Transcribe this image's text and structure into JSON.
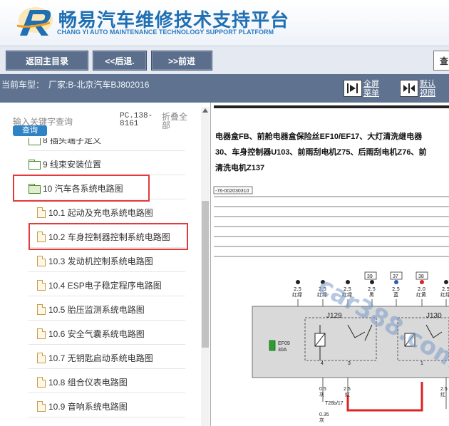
{
  "header": {
    "title_cn": "畅易汽车维修技术支持平台",
    "title_en": "CHANG YI AUTO MAINTENANCE TECHNOLOGY SUPPORT PLATFORM",
    "logo_icon": "cy-logo-icon"
  },
  "toolbar": {
    "home_label": "返回主目录",
    "back_label": "<<后退.",
    "forward_label": ">>前进",
    "query_label": "查"
  },
  "infobar": {
    "model_label": "当前车型：",
    "model_value": "厂家:B-北京汽车BJ802016",
    "fullscreen_label_1": "全屏",
    "fullscreen_label_2": "菜单",
    "default_label_1": "默认",
    "default_label_2": "视图"
  },
  "left": {
    "search_placeholder": "输入关键字查询",
    "search_button": "查询",
    "pc_code_1": "PC.138-",
    "pc_code_2": "8161",
    "collapse_1": "折叠全",
    "collapse_2": "部",
    "tree": [
      {
        "label": "8 插头端子定义",
        "type": "folder",
        "depth": 0
      },
      {
        "label": "9 线束安装位置",
        "type": "folder",
        "depth": 0
      },
      {
        "label": "10 汽车各系统电路图",
        "type": "folder-open",
        "depth": 0,
        "highlight": true
      },
      {
        "label": "10.1 起动及充电系统电路图",
        "type": "doc",
        "depth": 1
      },
      {
        "label": "10.2 车身控制器控制系统电路图",
        "type": "doc",
        "depth": 1,
        "highlight": true
      },
      {
        "label": "10.3 发动机控制系统电路图",
        "type": "doc",
        "depth": 1
      },
      {
        "label": "10.4 ESP电子稳定程序电路图",
        "type": "doc",
        "depth": 1
      },
      {
        "label": "10.5 胎压监测系统电路图",
        "type": "doc",
        "depth": 1
      },
      {
        "label": "10.6 安全气囊系统电路图",
        "type": "doc",
        "depth": 1
      },
      {
        "label": "10.7 无钥匙启动系统电路图",
        "type": "doc",
        "depth": 1
      },
      {
        "label": "10.8 组合仪表电路图",
        "type": "doc",
        "depth": 1
      },
      {
        "label": "10.9 音响系统电路图",
        "type": "doc",
        "depth": 1
      }
    ]
  },
  "diagram": {
    "line1": "电器盒FB、前舱电器盒保险丝EF10/EF17、大灯清洗继电器",
    "line2": "30、车身控制器U103、前雨刮电机Z75、后雨刮电机Z76、前",
    "line3": "清洗电机Z137",
    "ref_code": "-76-002030310",
    "wires": [
      {
        "size": "2.5",
        "color": "红绿"
      },
      {
        "size": "2.5",
        "color": "红绿"
      },
      {
        "size": "2.5",
        "color": "红绿"
      },
      {
        "size": "2.5",
        "color": "黑"
      },
      {
        "size": "2.5",
        "color": "蓝"
      },
      {
        "size": "2.0",
        "color": "红黄"
      },
      {
        "size": "2.5",
        "color": "红绿"
      }
    ],
    "pins": [
      "39",
      "37",
      "38"
    ],
    "relay1": "J129",
    "relay2": "J130",
    "fuse_name": "EF09",
    "fuse_rating": "30A",
    "bottom_pin_a": "4",
    "bottom_pin_b": "3",
    "bottom_pin_c": "1",
    "lower_wires": [
      {
        "size": "0.5",
        "color": "灰"
      },
      {
        "size": "2.5",
        "color": "红"
      },
      {
        "size": "2.5",
        "color": "红"
      }
    ],
    "connector": "T28b/17",
    "lower_wire_a_size": "0.35",
    "lower_wire_a_color": "灰",
    "watermark": "car388.com"
  }
}
